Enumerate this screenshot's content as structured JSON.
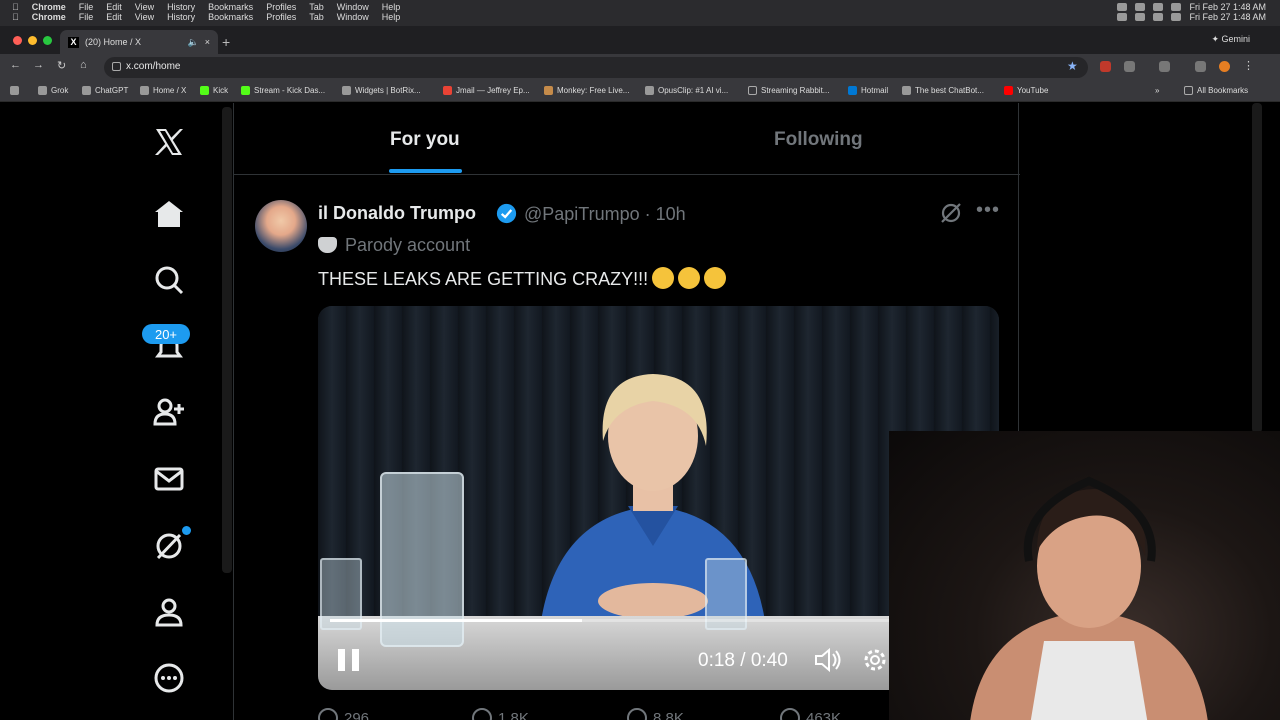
{
  "menubar": {
    "app": "Chrome",
    "items": [
      "File",
      "Edit",
      "View",
      "History",
      "Bookmarks",
      "Profiles",
      "Tab",
      "Window",
      "Help"
    ],
    "clock": "Fri Feb 27  1:48 AM"
  },
  "tab": {
    "title": "(20) Home / X",
    "favicon": "X"
  },
  "gemini": "Gemini",
  "address": {
    "url": "x.com/home"
  },
  "bookmarks": [
    {
      "label": "Grok"
    },
    {
      "label": "ChatGPT"
    },
    {
      "label": "Home / X"
    },
    {
      "label": "Kick"
    },
    {
      "label": "Stream - Kick Das..."
    },
    {
      "label": "Widgets | BotRix..."
    },
    {
      "label": "Jmail — Jeffrey Ep..."
    },
    {
      "label": "Monkey: Free Live..."
    },
    {
      "label": "OpusClip: #1 AI vi..."
    },
    {
      "label": "Streaming Rabbit..."
    },
    {
      "label": "Hotmail"
    },
    {
      "label": "The best ChatBot..."
    },
    {
      "label": "YouTube"
    }
  ],
  "all_bookmarks": "All Bookmarks",
  "sidebar": {
    "notifications_badge": "20+"
  },
  "feed": {
    "tabs": [
      {
        "label": "For you",
        "active": true
      },
      {
        "label": "Following",
        "active": false
      }
    ]
  },
  "post": {
    "display_name": "il Donaldo Trumpo",
    "handle_time": "@PapiTrumpo · 10h",
    "label": "Parody account",
    "text": "THESE LEAKS ARE GETTING CRAZY!!!",
    "video": {
      "time": "0:18 / 0:40",
      "progress": 0.45
    },
    "actions": {
      "replies": "296",
      "reposts": "1.8K",
      "likes": "8.8K",
      "views": "463K"
    }
  },
  "colors": {
    "accent": "#1d9bf0",
    "muted": "#71767b"
  }
}
